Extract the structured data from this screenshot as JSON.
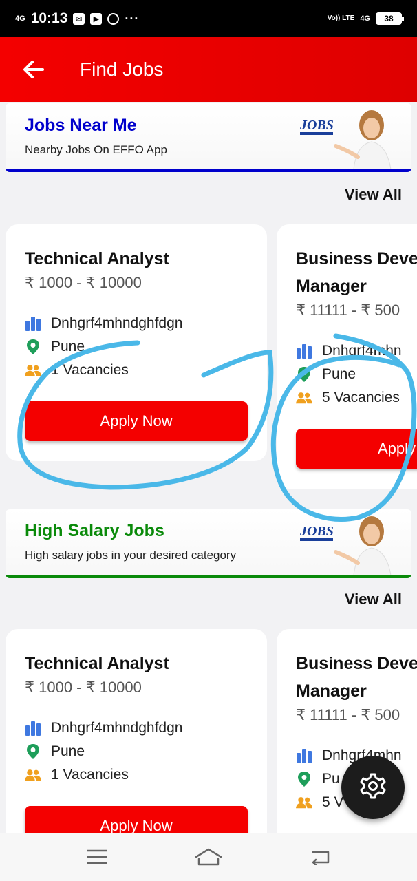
{
  "status_bar": {
    "network": "4G",
    "time": "10:13",
    "volte": "Vo)) LTE",
    "network2": "4G",
    "battery": "38",
    "more": "···"
  },
  "app_bar": {
    "title": "Find Jobs"
  },
  "sections": [
    {
      "title": "Jobs Near Me",
      "subtitle": "Nearby Jobs On EFFO App",
      "view_all": "View All",
      "accent": "#0000cc",
      "art_text": "JOBS",
      "jobs": [
        {
          "title": "Technical Analyst",
          "salary": "₹ 1000 - ₹ 10000",
          "company": "Dnhgrf4mhndghfdgn",
          "location": "Pune",
          "vacancies": "1 Vacancies",
          "apply": "Apply Now"
        },
        {
          "title_line1": "Business Deve",
          "title_line2": "Manager",
          "salary": "₹ 11111 - ₹ 500",
          "company": "Dnhgrf4mhn",
          "location": "Pune",
          "vacancies": "5 Vacancies",
          "apply": "Apply"
        }
      ]
    },
    {
      "title": "High Salary Jobs",
      "subtitle": "High salary jobs in your desired category",
      "view_all": "View All",
      "accent": "#0a8a0a",
      "art_text": "JOBS",
      "jobs": [
        {
          "title": "Technical Analyst",
          "salary": "₹ 1000 - ₹ 10000",
          "company": "Dnhgrf4mhndghfdgn",
          "location": "Pune",
          "vacancies": "1 Vacancies",
          "apply": "Apply Now"
        },
        {
          "title_line1": "Business Deve",
          "title_line2": "Manager",
          "salary": "₹ 11111 - ₹ 500",
          "company": "Dnhgrf4mhn",
          "location": "Pu",
          "vacancies": "5 V",
          "apply": ""
        }
      ]
    }
  ],
  "colors": {
    "primary_red": "#f40000",
    "annotation_blue": "#4ab8e8",
    "blue_title": "#0000cc",
    "green_title": "#0a8a0a"
  },
  "icons": {
    "back": "arrow-left-icon",
    "company": "bar-chart-icon",
    "location": "map-pin-icon",
    "vacancies": "people-icon",
    "settings": "gear-icon",
    "nav_menu": "menu-icon",
    "nav_home": "home-icon",
    "nav_back": "back-nav-icon"
  }
}
